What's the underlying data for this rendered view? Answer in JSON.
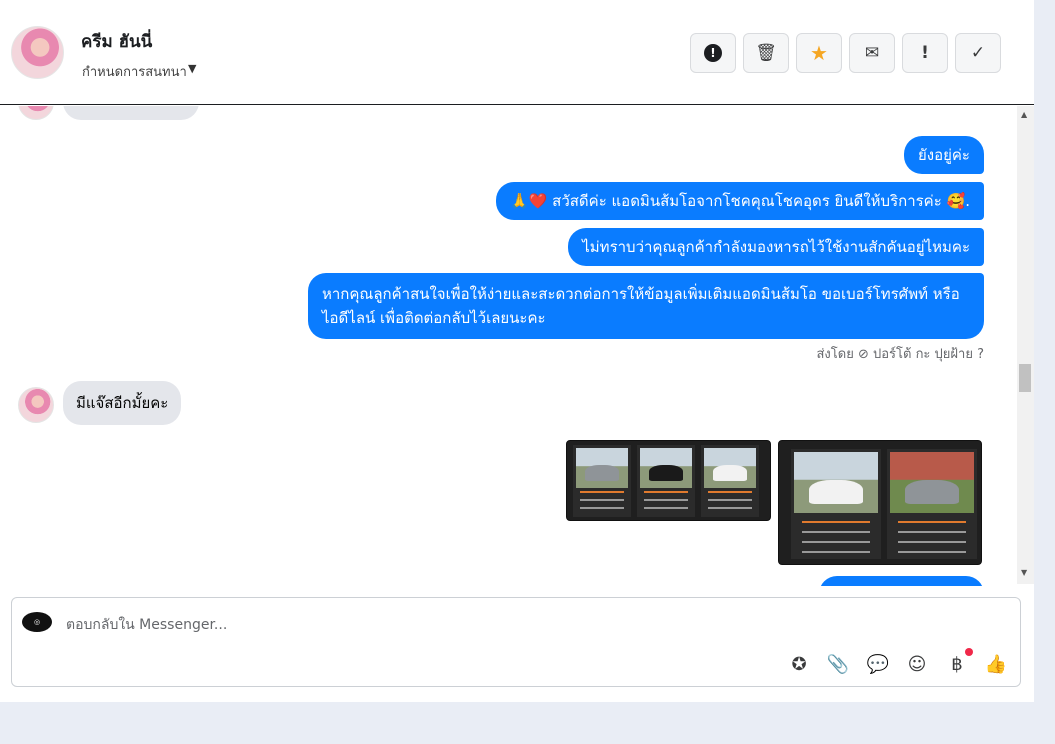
{
  "header": {
    "contact_name": "ครีม ฮันนี่",
    "assign_label": "กำหนดการสนทนา",
    "caret": "▼",
    "buttons": [
      {
        "icon": "alert-circle-icon",
        "glyph": "❗"
      },
      {
        "icon": "trash-icon",
        "glyph": "🗑"
      },
      {
        "icon": "star-icon",
        "glyph": "★"
      },
      {
        "icon": "mark-unread-icon",
        "glyph": "✉"
      },
      {
        "icon": "exclamation-icon",
        "glyph": "!"
      },
      {
        "icon": "check-icon",
        "glyph": "✓"
      }
    ]
  },
  "messages": {
    "out_1": "ยังอยู่ค่ะ",
    "out_2": "🙏❤️ สวัสดีค่ะ แอดมินส้มโอจากโชคคุณโชคอุดร ยินดีให้บริการค่ะ 🥰.",
    "out_3": "ไม่ทราบว่าคุณลูกค้ากำลังมองหารถไว้ใช้งานสักคันอยู่ไหมคะ",
    "out_4": "หากคุณลูกค้าสนใจเพื่อให้ง่ายและสะดวกต่อการให้ข้อมูลเพิ่มเติมแอดมินส้มโอ ขอเบอร์โทรศัพท์ หรือ ไอดีไลน์ เพื่อติดต่อกลับไว้เลยนะคะ",
    "sent_by": "ส่งโดย ⊘ ปอร์โต้ กะ ปุยฝ้าย ?",
    "in_1": "มีแจ๊สอีกมั้ยคะ"
  },
  "composer": {
    "placeholder": "ตอบกลับใน Messenger...",
    "icons": [
      "saved-reply-icon",
      "attachment-icon",
      "chat-icon",
      "emoji-icon",
      "baht-payment-icon",
      "thumbs-up-icon"
    ],
    "glyphs": [
      "✪",
      "📎",
      "💬",
      "☺",
      "฿",
      "👍"
    ]
  },
  "colors": {
    "bubble_out": "#0a7cff",
    "bubble_in": "#e4e6eb",
    "star": "#f5a623",
    "notification": "#f02849"
  }
}
